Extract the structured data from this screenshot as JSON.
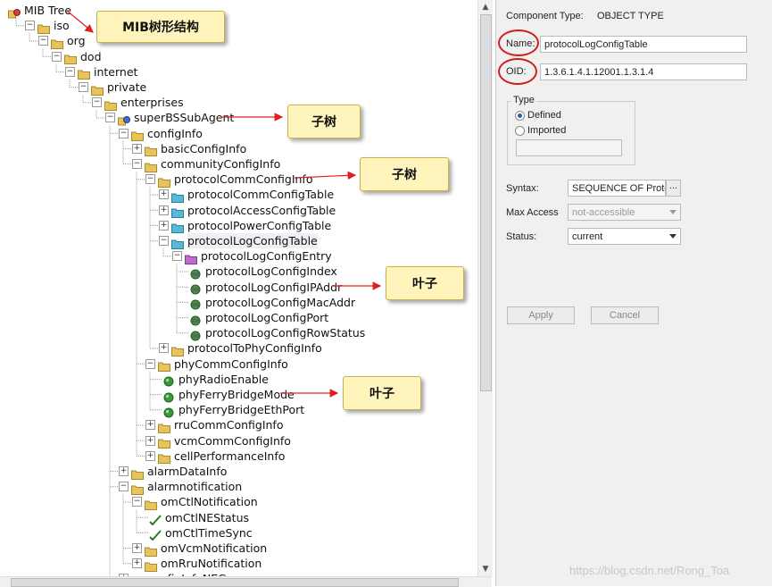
{
  "tree": {
    "nodes": [
      {
        "label": "MIB Tree",
        "depth": 0,
        "icon": "mib-root-icon",
        "expander": "none"
      },
      {
        "label": "iso",
        "depth": 1,
        "icon": "folder-icon",
        "expander": "minus"
      },
      {
        "label": "org",
        "depth": 2,
        "icon": "folder-icon",
        "expander": "minus"
      },
      {
        "label": "dod",
        "depth": 3,
        "icon": "folder-icon",
        "expander": "minus"
      },
      {
        "label": "internet",
        "depth": 4,
        "icon": "folder-icon",
        "expander": "minus"
      },
      {
        "label": "private",
        "depth": 5,
        "icon": "folder-icon",
        "expander": "minus"
      },
      {
        "label": "enterprises",
        "depth": 6,
        "icon": "folder-icon",
        "expander": "minus"
      },
      {
        "label": "superBSSubAgent",
        "depth": 7,
        "icon": "agent-icon",
        "expander": "minus"
      },
      {
        "label": "configInfo",
        "depth": 8,
        "icon": "folder-icon",
        "expander": "minus"
      },
      {
        "label": "basicConfigInfo",
        "depth": 9,
        "icon": "folder-icon",
        "expander": "plus"
      },
      {
        "label": "communityConfigInfo",
        "depth": 9,
        "icon": "folder-icon",
        "expander": "minus"
      },
      {
        "label": "protocolCommConfigInfo",
        "depth": 10,
        "icon": "folder-icon",
        "expander": "minus"
      },
      {
        "label": "protocolCommConfigTable",
        "depth": 11,
        "icon": "table-icon",
        "expander": "plus"
      },
      {
        "label": "protocolAccessConfigTable",
        "depth": 11,
        "icon": "table-icon",
        "expander": "plus"
      },
      {
        "label": "protocolPowerConfigTable",
        "depth": 11,
        "icon": "table-icon",
        "expander": "plus"
      },
      {
        "label": "protocolLogConfigTable",
        "depth": 11,
        "icon": "table-icon",
        "expander": "minus",
        "selected": true
      },
      {
        "label": "protocolLogConfigEntry",
        "depth": 12,
        "icon": "entry-icon",
        "expander": "minus"
      },
      {
        "label": "protocolLogConfigIndex",
        "depth": 13,
        "icon": "leaf-column-icon",
        "expander": "none"
      },
      {
        "label": "protocolLogConfigIPAddr",
        "depth": 13,
        "icon": "leaf-column-icon",
        "expander": "none"
      },
      {
        "label": "protocolLogConfigMacAddr",
        "depth": 13,
        "icon": "leaf-column-icon",
        "expander": "none"
      },
      {
        "label": "protocolLogConfigPort",
        "depth": 13,
        "icon": "leaf-column-icon",
        "expander": "none"
      },
      {
        "label": "protocolLogConfigRowStatus",
        "depth": 13,
        "icon": "leaf-column-icon",
        "expander": "none"
      },
      {
        "label": "protocolToPhyConfigInfo",
        "depth": 11,
        "icon": "folder-icon",
        "expander": "plus"
      },
      {
        "label": "phyCommConfigInfo",
        "depth": 10,
        "icon": "folder-icon",
        "expander": "minus"
      },
      {
        "label": "phyRadioEnable",
        "depth": 11,
        "icon": "leaf-scalar-icon",
        "expander": "none"
      },
      {
        "label": "phyFerryBridgeMode",
        "depth": 11,
        "icon": "leaf-scalar-icon",
        "expander": "none"
      },
      {
        "label": "phyFerryBridgeEthPort",
        "depth": 11,
        "icon": "leaf-scalar-icon",
        "expander": "none"
      },
      {
        "label": "rruCommConfigInfo",
        "depth": 10,
        "icon": "folder-icon",
        "expander": "plus"
      },
      {
        "label": "vcmCommConfigInfo",
        "depth": 10,
        "icon": "folder-icon",
        "expander": "plus"
      },
      {
        "label": "cellPerformanceInfo",
        "depth": 10,
        "icon": "folder-icon",
        "expander": "plus"
      },
      {
        "label": "alarmDataInfo",
        "depth": 8,
        "icon": "folder-icon",
        "expander": "plus"
      },
      {
        "label": "alarmnotification",
        "depth": 8,
        "icon": "folder-icon",
        "expander": "minus"
      },
      {
        "label": "omCtlNotification",
        "depth": 9,
        "icon": "folder-icon",
        "expander": "minus"
      },
      {
        "label": "omCtlNEStatus",
        "depth": 10,
        "icon": "notification-icon",
        "expander": "none"
      },
      {
        "label": "omCtlTimeSync",
        "depth": 10,
        "icon": "notification-icon",
        "expander": "none"
      },
      {
        "label": "omVcmNotification",
        "depth": 9,
        "icon": "folder-icon",
        "expander": "plus"
      },
      {
        "label": "omRruNotification",
        "depth": 9,
        "icon": "folder-icon",
        "expander": "plus"
      },
      {
        "label": "configInfoNEGroup",
        "depth": 8,
        "icon": "group-icon",
        "expander": "plus"
      }
    ]
  },
  "annotations": [
    {
      "text": "MIB树形结构"
    },
    {
      "text": "子树"
    },
    {
      "text": "子树"
    },
    {
      "text": "叶子"
    },
    {
      "text": "叶子"
    }
  ],
  "props": {
    "component_type_label": "Component Type:",
    "component_type_value": "OBJECT TYPE",
    "name_label": "Name:",
    "name_value": "protocolLogConfigTable",
    "oid_label": "OID:",
    "oid_value": "1.3.6.1.4.1.12001.1.3.1.4",
    "type_group_label": "Type",
    "type_defined": "Defined",
    "type_imported": "Imported",
    "type_selected": "Defined",
    "syntax_label": "Syntax:",
    "syntax_value": "SEQUENCE OF Protoc",
    "syntax_button": "...",
    "max_access_label": "Max Access",
    "max_access_value": "not-accessible",
    "status_label": "Status:",
    "status_value": "current",
    "apply_button": "Apply",
    "cancel_button": "Cancel"
  },
  "colors": {
    "folder": "#e8c35a",
    "table": "#5ab7d6",
    "entry": "#c06ad0",
    "leaf": "#3a9a3a",
    "highlight_ellipse": "#cc2020",
    "arrow": "#e02020",
    "callout_bg": "#fff4bb"
  },
  "watermark": "https://blog.csdn.net/Rong_Toa"
}
